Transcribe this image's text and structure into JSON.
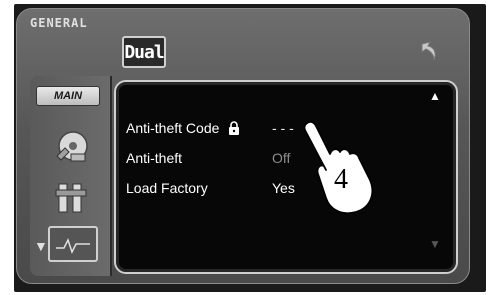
{
  "header": {
    "label": "GENERAL",
    "logo": "Dual",
    "back_icon": "back-arrow-icon"
  },
  "sidebar": {
    "main_tab": "MAIN",
    "icons": [
      "media-disc-icon",
      "tools-icon",
      "display-icon"
    ]
  },
  "settings": [
    {
      "label": "Anti-theft  Code",
      "value": "- - -",
      "icon": "lock-icon"
    },
    {
      "label": "Anti-theft",
      "value": "Off"
    },
    {
      "label": "Load Factory",
      "value": "Yes"
    }
  ],
  "scroll": {
    "up_icon": "arrow-up-icon",
    "down_icon": "arrow-down-icon"
  },
  "annotation": {
    "step_number": "4"
  },
  "colors": {
    "accent": "#ffffff",
    "disabled": "#8c8c8c",
    "panel": "#070707"
  }
}
